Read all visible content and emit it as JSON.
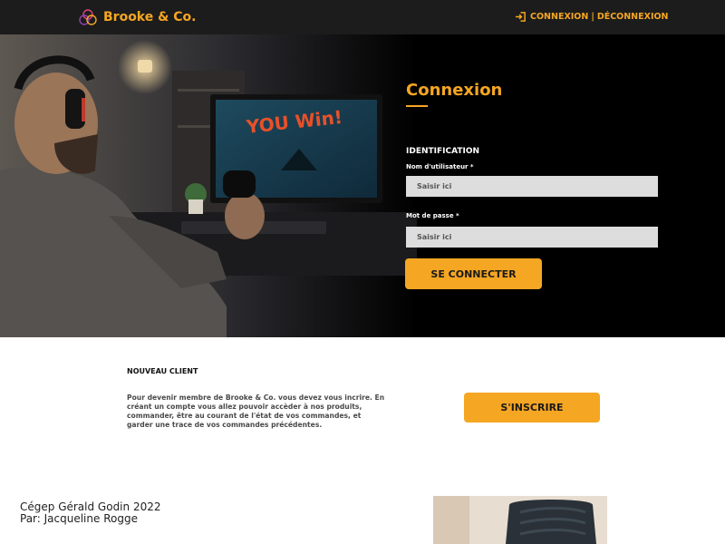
{
  "header": {
    "brand": "Brooke & Co.",
    "login_link": "CONNEXION",
    "separator": "|",
    "logout_link": "DÉCONNEXION"
  },
  "login": {
    "title": "Connexion",
    "section_label": "IDENTIFICATION",
    "username_label": "Nom d'utilisateur *",
    "username_placeholder": "Saisir ici",
    "password_label": "Mot de passe *",
    "password_placeholder": "Saisir ici",
    "submit_label": "SE CONNECTER"
  },
  "new_client": {
    "title": "NOUVEAU CLIENT",
    "description": "Pour devenir membre de Brooke & Co.  vous devez vous incrire. En créant un compte vous allez pouvoir accèder à nos produits, commander, être au courant de l'état de vos commandes, et garder une trace de vos commandes précédentes.",
    "signup_label": "S'INSCRIRE"
  },
  "credits": {
    "line1": "Cégep Gérald Godin 2022",
    "line2": "Par: Jacqueline Rogge"
  },
  "colors": {
    "accent": "#f5a623",
    "topbar": "#1c1c1c",
    "hero_bg": "#000000"
  },
  "icons": {
    "brand": "three-circles-logo-icon",
    "login": "login-arrow-icon"
  }
}
